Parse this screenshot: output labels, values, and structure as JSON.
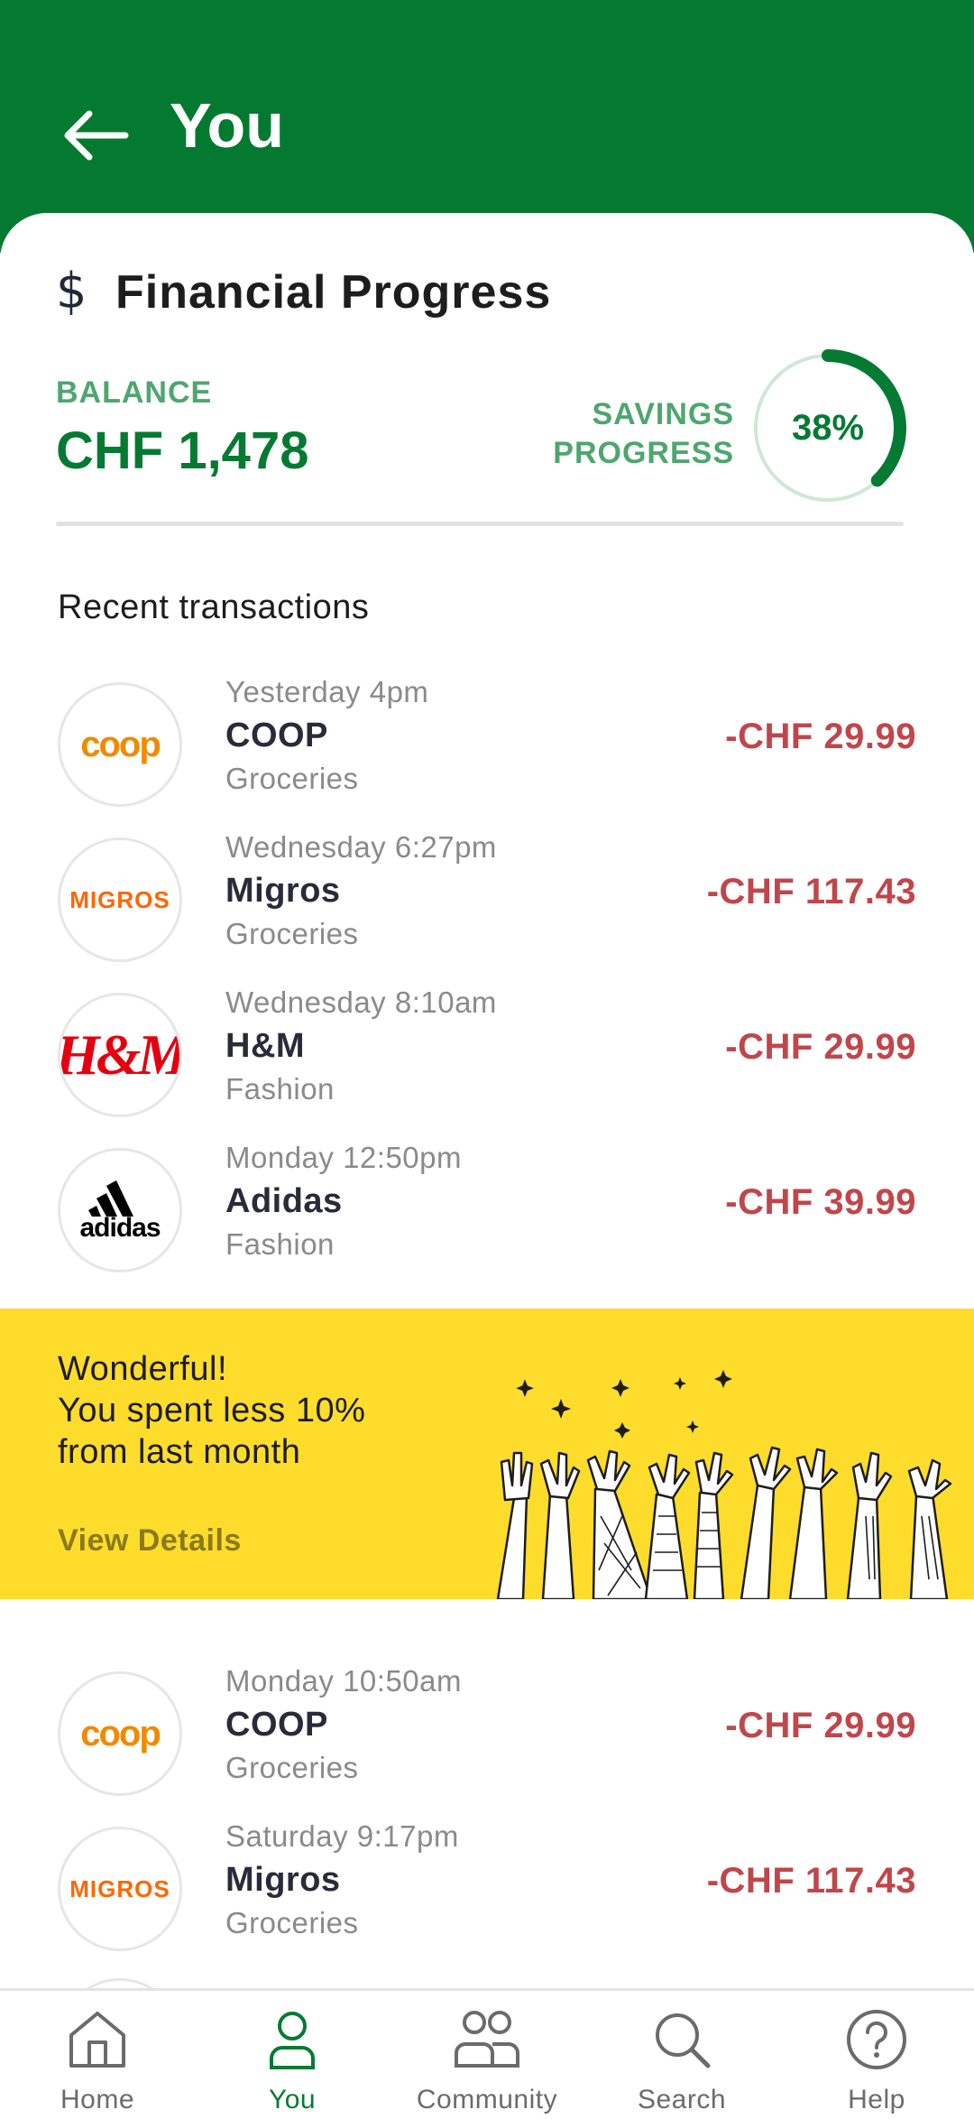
{
  "header": {
    "title": "You"
  },
  "financial": {
    "title": "Financial Progress",
    "balance_label": "BALANCE",
    "balance_value": "CHF 1,478",
    "savings_label_line1": "SAVINGS",
    "savings_label_line2": "PROGRESS",
    "savings_percent": 38,
    "savings_percent_text": "38%",
    "accent_color": "#057a33"
  },
  "recent": {
    "title": "Recent transactions",
    "transactions": [
      {
        "time": "Yesterday 4pm",
        "merchant": "COOP",
        "category": "Groceries",
        "amount": "-CHF 29.99",
        "logo": "coop"
      },
      {
        "time": "Wednesday 6:27pm",
        "merchant": "Migros",
        "category": "Groceries",
        "amount": "-CHF 117.43",
        "logo": "MIGROS"
      },
      {
        "time": "Wednesday 8:10am",
        "merchant": "H&M",
        "category": "Fashion",
        "amount": "-CHF 29.99",
        "logo": "H&M"
      },
      {
        "time": "Monday 12:50pm",
        "merchant": "Adidas",
        "category": "Fashion",
        "amount": "-CHF 39.99",
        "logo": "adidas"
      }
    ]
  },
  "banner": {
    "line1": "Wonderful!",
    "line2": "You spent less 10%",
    "line3": "from last month",
    "link": "View Details",
    "color": "#fedc2c"
  },
  "more_transactions": [
    {
      "time": "Monday 10:50am",
      "merchant": "COOP",
      "category": "Groceries",
      "amount": "-CHF 29.99",
      "logo": "coop"
    },
    {
      "time": "Saturday 9:17pm",
      "merchant": "Migros",
      "category": "Groceries",
      "amount": "-CHF 117.43",
      "logo": "MIGROS"
    }
  ],
  "nav": {
    "items": [
      {
        "label": "Home",
        "icon": "home-icon"
      },
      {
        "label": "You",
        "icon": "person-icon",
        "active": true
      },
      {
        "label": "Community",
        "icon": "community-icon"
      },
      {
        "label": "Search",
        "icon": "search-icon"
      },
      {
        "label": "Help",
        "icon": "help-icon"
      }
    ]
  }
}
